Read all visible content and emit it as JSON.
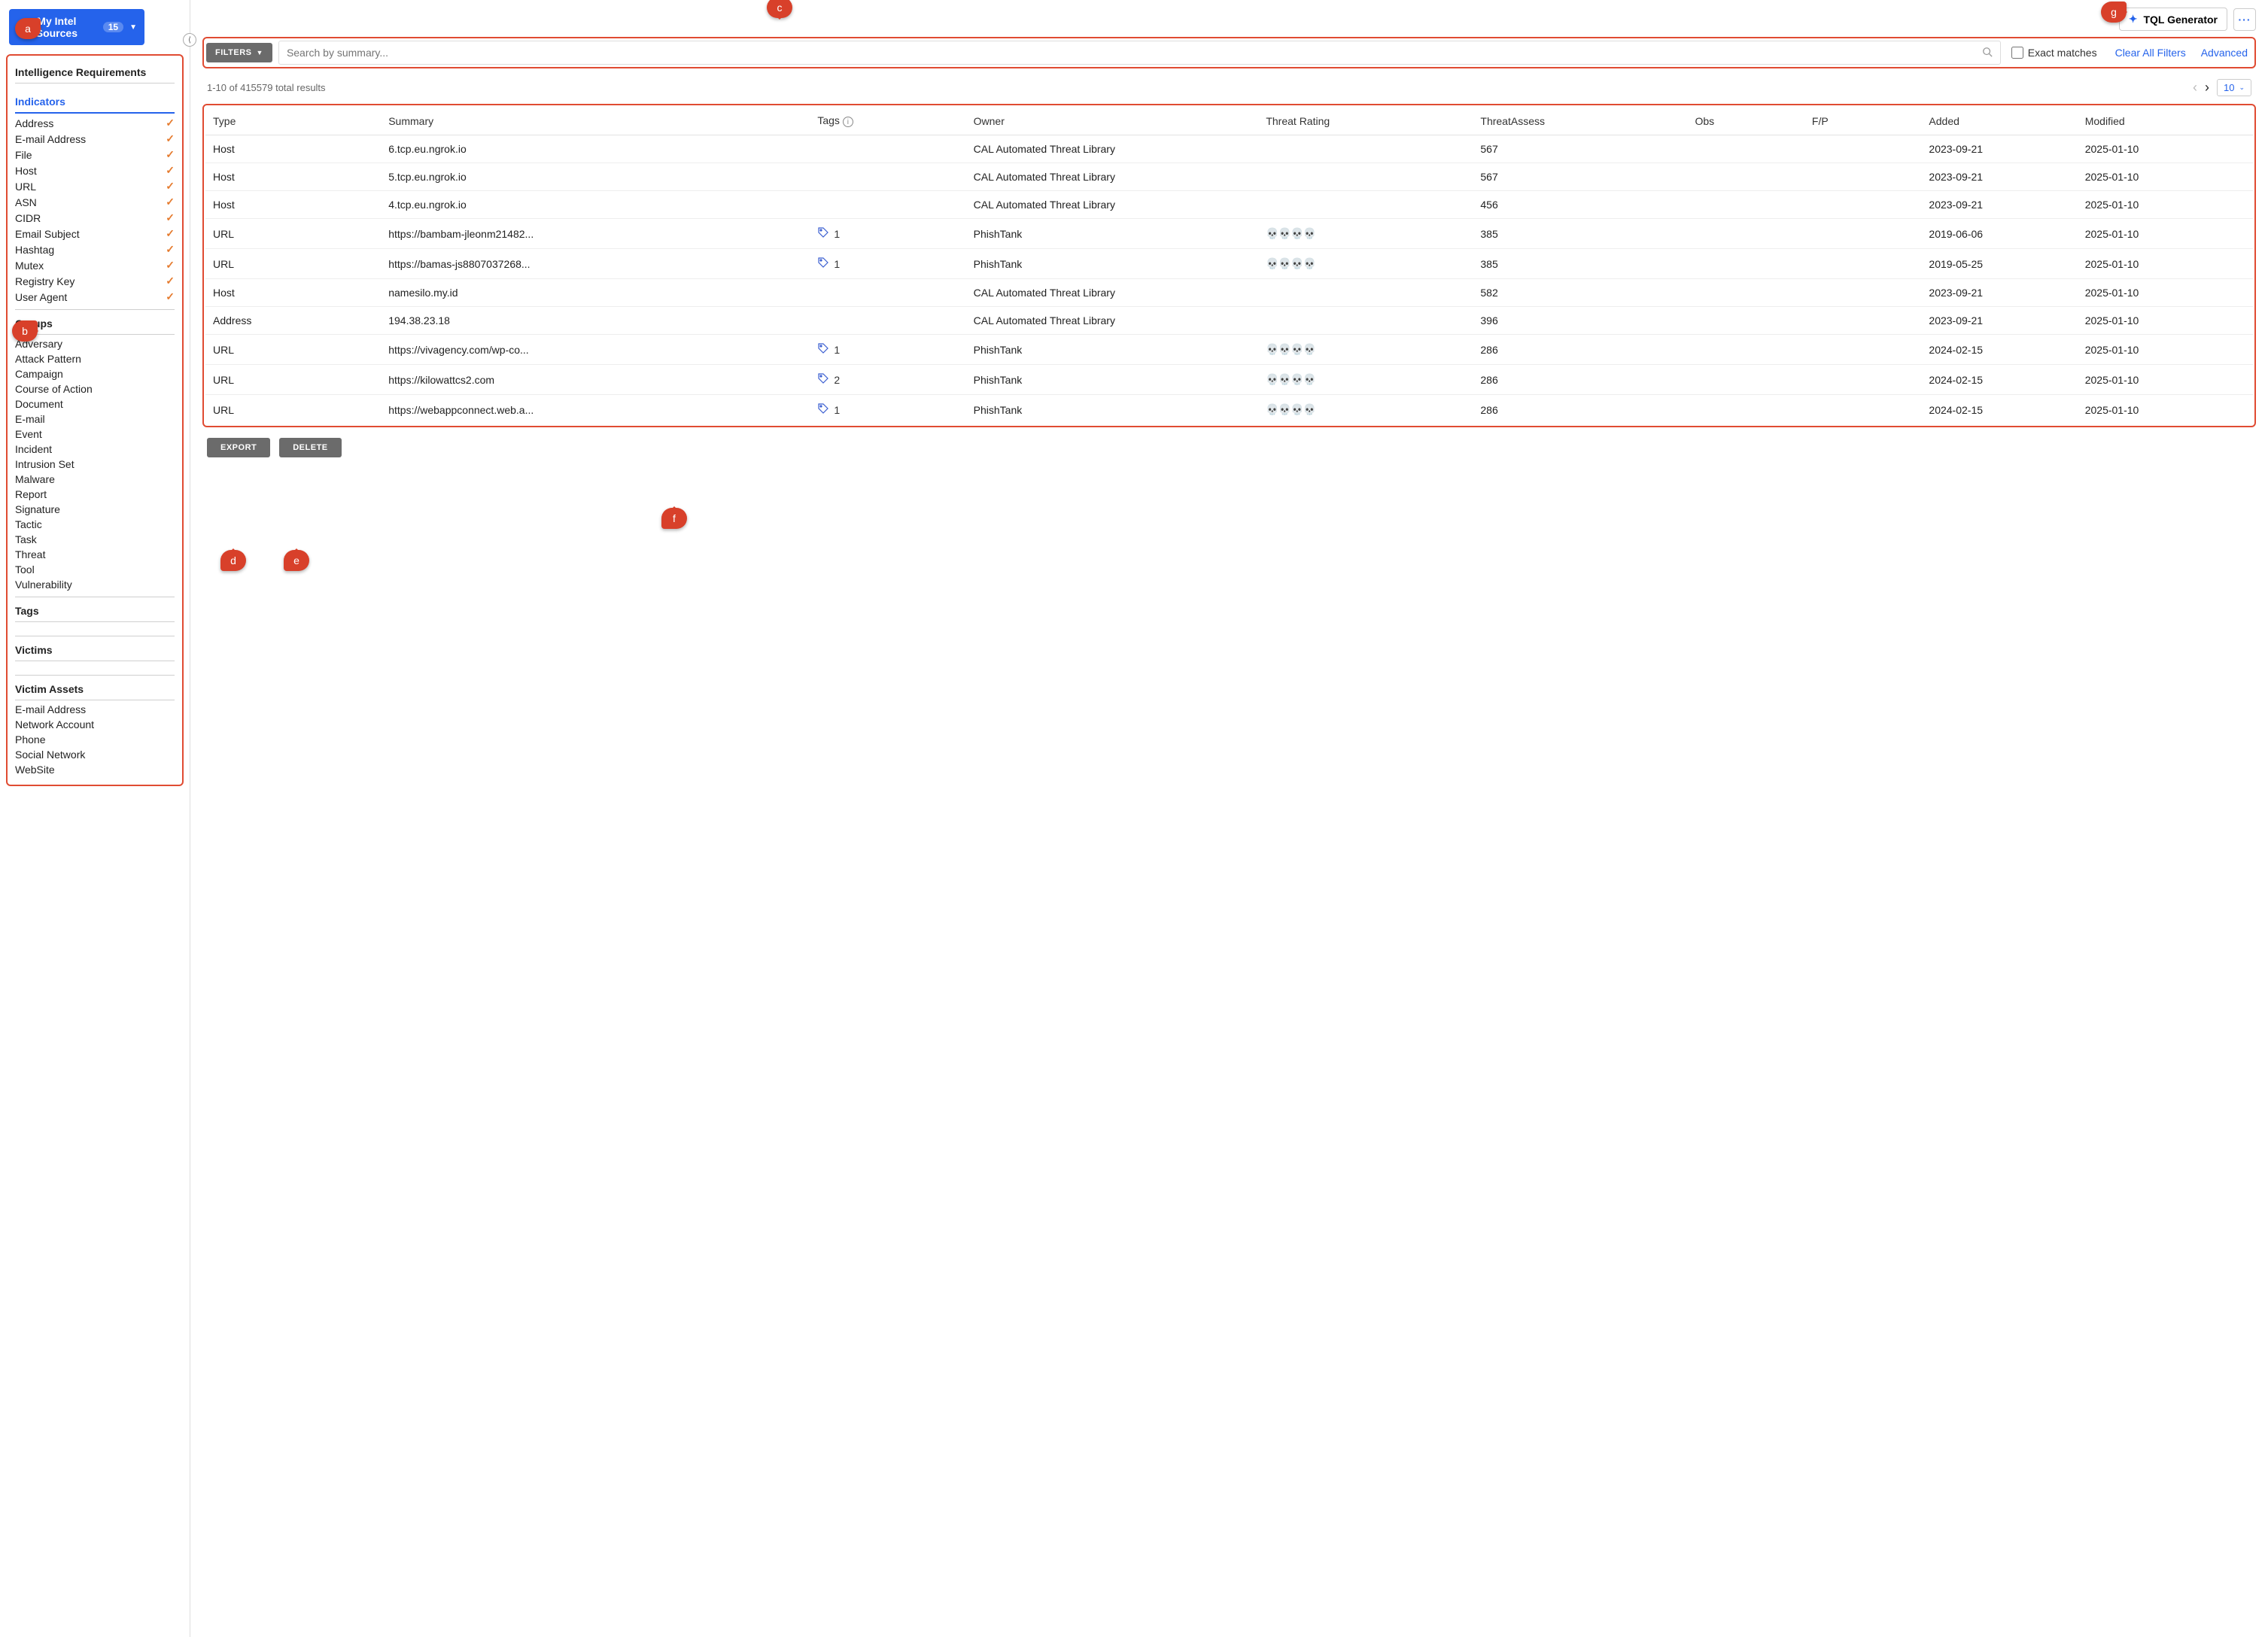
{
  "header": {
    "intel_sources_label": "My Intel Sources",
    "intel_sources_count": "15",
    "tql_label": "TQL Generator"
  },
  "sidebar": {
    "intel_req_label": "Intelligence Requirements",
    "indicators_label": "Indicators",
    "indicators": [
      {
        "label": "Address",
        "checked": true
      },
      {
        "label": "E-mail Address",
        "checked": true
      },
      {
        "label": "File",
        "checked": true
      },
      {
        "label": "Host",
        "checked": true
      },
      {
        "label": "URL",
        "checked": true
      },
      {
        "label": "ASN",
        "checked": true
      },
      {
        "label": "CIDR",
        "checked": true
      },
      {
        "label": "Email Subject",
        "checked": true
      },
      {
        "label": "Hashtag",
        "checked": true
      },
      {
        "label": "Mutex",
        "checked": true
      },
      {
        "label": "Registry Key",
        "checked": true
      },
      {
        "label": "User Agent",
        "checked": true
      }
    ],
    "groups_label": "Groups",
    "groups": [
      "Adversary",
      "Attack Pattern",
      "Campaign",
      "Course of Action",
      "Document",
      "E-mail",
      "Event",
      "Incident",
      "Intrusion Set",
      "Malware",
      "Report",
      "Signature",
      "Tactic",
      "Task",
      "Threat",
      "Tool",
      "Vulnerability"
    ],
    "tags_label": "Tags",
    "victims_label": "Victims",
    "victim_assets_label": "Victim Assets",
    "victim_assets": [
      "E-mail Address",
      "Network Account",
      "Phone",
      "Social Network",
      "WebSite"
    ]
  },
  "filter_bar": {
    "filters_btn": "FILTERS",
    "search_placeholder": "Search by summary...",
    "exact_label": "Exact matches",
    "clear_label": "Clear All Filters",
    "advanced_label": "Advanced"
  },
  "results": {
    "summary": "1-10 of 415579 total results",
    "page_size": "10"
  },
  "columns": {
    "type": "Type",
    "summary": "Summary",
    "tags": "Tags",
    "owner": "Owner",
    "rating": "Threat Rating",
    "assess": "ThreatAssess",
    "obs": "Obs",
    "fp": "F/P",
    "added": "Added",
    "modified": "Modified"
  },
  "rows": [
    {
      "type": "Host",
      "summary": "6.tcp.eu.ngrok.io",
      "tags": null,
      "owner": "CAL Automated Threat Library",
      "rating": 0,
      "assess": "567",
      "added": "2023-09-21",
      "modified": "2025-01-10"
    },
    {
      "type": "Host",
      "summary": "5.tcp.eu.ngrok.io",
      "tags": null,
      "owner": "CAL Automated Threat Library",
      "rating": 0,
      "assess": "567",
      "added": "2023-09-21",
      "modified": "2025-01-10"
    },
    {
      "type": "Host",
      "summary": "4.tcp.eu.ngrok.io",
      "tags": null,
      "owner": "CAL Automated Threat Library",
      "rating": 0,
      "assess": "456",
      "added": "2023-09-21",
      "modified": "2025-01-10"
    },
    {
      "type": "URL",
      "summary": "https://bambam-jleonm21482...",
      "tags": "1",
      "owner": "PhishTank",
      "rating": 4,
      "assess": "385",
      "added": "2019-06-06",
      "modified": "2025-01-10"
    },
    {
      "type": "URL",
      "summary": "https://bamas-js8807037268...",
      "tags": "1",
      "owner": "PhishTank",
      "rating": 4,
      "assess": "385",
      "added": "2019-05-25",
      "modified": "2025-01-10"
    },
    {
      "type": "Host",
      "summary": "namesilo.my.id",
      "tags": null,
      "owner": "CAL Automated Threat Library",
      "rating": 0,
      "assess": "582",
      "added": "2023-09-21",
      "modified": "2025-01-10"
    },
    {
      "type": "Address",
      "summary": "194.38.23.18",
      "tags": null,
      "owner": "CAL Automated Threat Library",
      "rating": 0,
      "assess": "396",
      "added": "2023-09-21",
      "modified": "2025-01-10"
    },
    {
      "type": "URL",
      "summary": "https://vivagency.com/wp-co...",
      "tags": "1",
      "owner": "PhishTank",
      "rating": 4,
      "assess": "286",
      "added": "2024-02-15",
      "modified": "2025-01-10"
    },
    {
      "type": "URL",
      "summary": "https://kilowattcs2.com",
      "tags": "2",
      "owner": "PhishTank",
      "rating": 4,
      "assess": "286",
      "added": "2024-02-15",
      "modified": "2025-01-10"
    },
    {
      "type": "URL",
      "summary": "https://webappconnect.web.a...",
      "tags": "1",
      "owner": "PhishTank",
      "rating": 4,
      "assess": "286",
      "added": "2024-02-15",
      "modified": "2025-01-10"
    }
  ],
  "actions": {
    "export": "EXPORT",
    "delete": "DELETE"
  },
  "callouts": {
    "a": "a",
    "b": "b",
    "c": "c",
    "d": "d",
    "e": "e",
    "f": "f",
    "g": "g"
  }
}
